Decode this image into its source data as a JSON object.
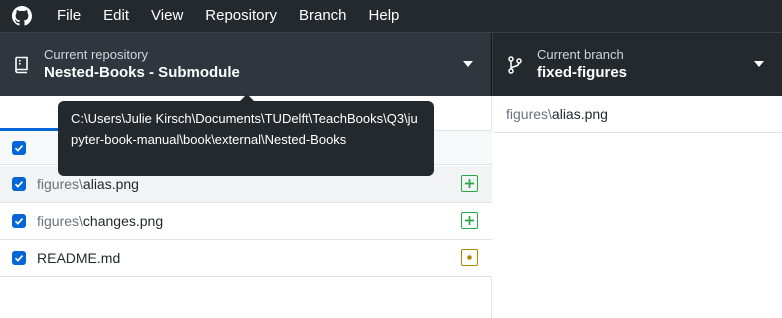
{
  "menubar": {
    "items": [
      "File",
      "Edit",
      "View",
      "Repository",
      "Branch",
      "Help"
    ]
  },
  "toolbar": {
    "repository": {
      "label": "Current repository",
      "value": "Nested-Books - Submodule"
    },
    "branch": {
      "label": "Current branch",
      "value": "fixed-figures"
    }
  },
  "tooltip": {
    "text": "C:\\Users\\Julie Kirsch\\Documents\\TUDelft\\TeachBooks\\Q3\\jupyter-book-manual\\book\\external\\Nested-Books"
  },
  "changes": {
    "files": [
      {
        "dir": "figures\\",
        "name": "alias.png",
        "status": "added",
        "checked": true
      },
      {
        "dir": "figures\\",
        "name": "changes.png",
        "status": "added",
        "checked": true
      },
      {
        "dir": "",
        "name": "README.md",
        "status": "modified",
        "checked": true
      }
    ]
  },
  "diff": {
    "dir": "figures\\",
    "name": "alias.png"
  },
  "colors": {
    "chrome": "#24292e",
    "accent": "#0366d6",
    "added": "#28a745",
    "modified": "#b08800"
  }
}
